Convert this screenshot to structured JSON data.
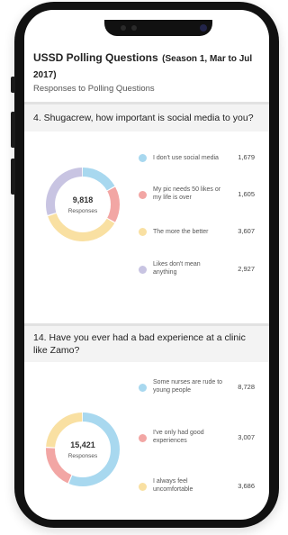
{
  "header": {
    "title": "USSD Polling Questions",
    "season": "(Season 1, Mar to Jul 2017)",
    "subtitle": "Responses to Polling Questions"
  },
  "questions": [
    {
      "text": "4. Shugacrew, how important is social media to you?",
      "total": "9,818",
      "total_label": "Responses",
      "answers": [
        {
          "label": "I don't use social media",
          "value": 1679,
          "display": "1,679",
          "color": "#a8d8ef"
        },
        {
          "label": "My pic needs 50 likes or my life is over",
          "value": 1605,
          "display": "1,605",
          "color": "#f2a6a4"
        },
        {
          "label": "The more the better",
          "value": 3607,
          "display": "3,607",
          "color": "#f9e0a2"
        },
        {
          "label": "Likes don't mean anything",
          "value": 2927,
          "display": "2,927",
          "color": "#c8c4e2"
        }
      ]
    },
    {
      "text": "14. Have you ever had a bad experience at a clinic like Zamo?",
      "total": "15,421",
      "total_label": "Responses",
      "answers": [
        {
          "label": "Some nurses are rude to young people",
          "value": 8728,
          "display": "8,728",
          "color": "#a8d8ef"
        },
        {
          "label": "I've only had good experiences",
          "value": 3007,
          "display": "3,007",
          "color": "#f2a6a4"
        },
        {
          "label": "I always feel uncomfortable",
          "value": 3686,
          "display": "3,686",
          "color": "#f9e0a2"
        }
      ]
    }
  ]
}
